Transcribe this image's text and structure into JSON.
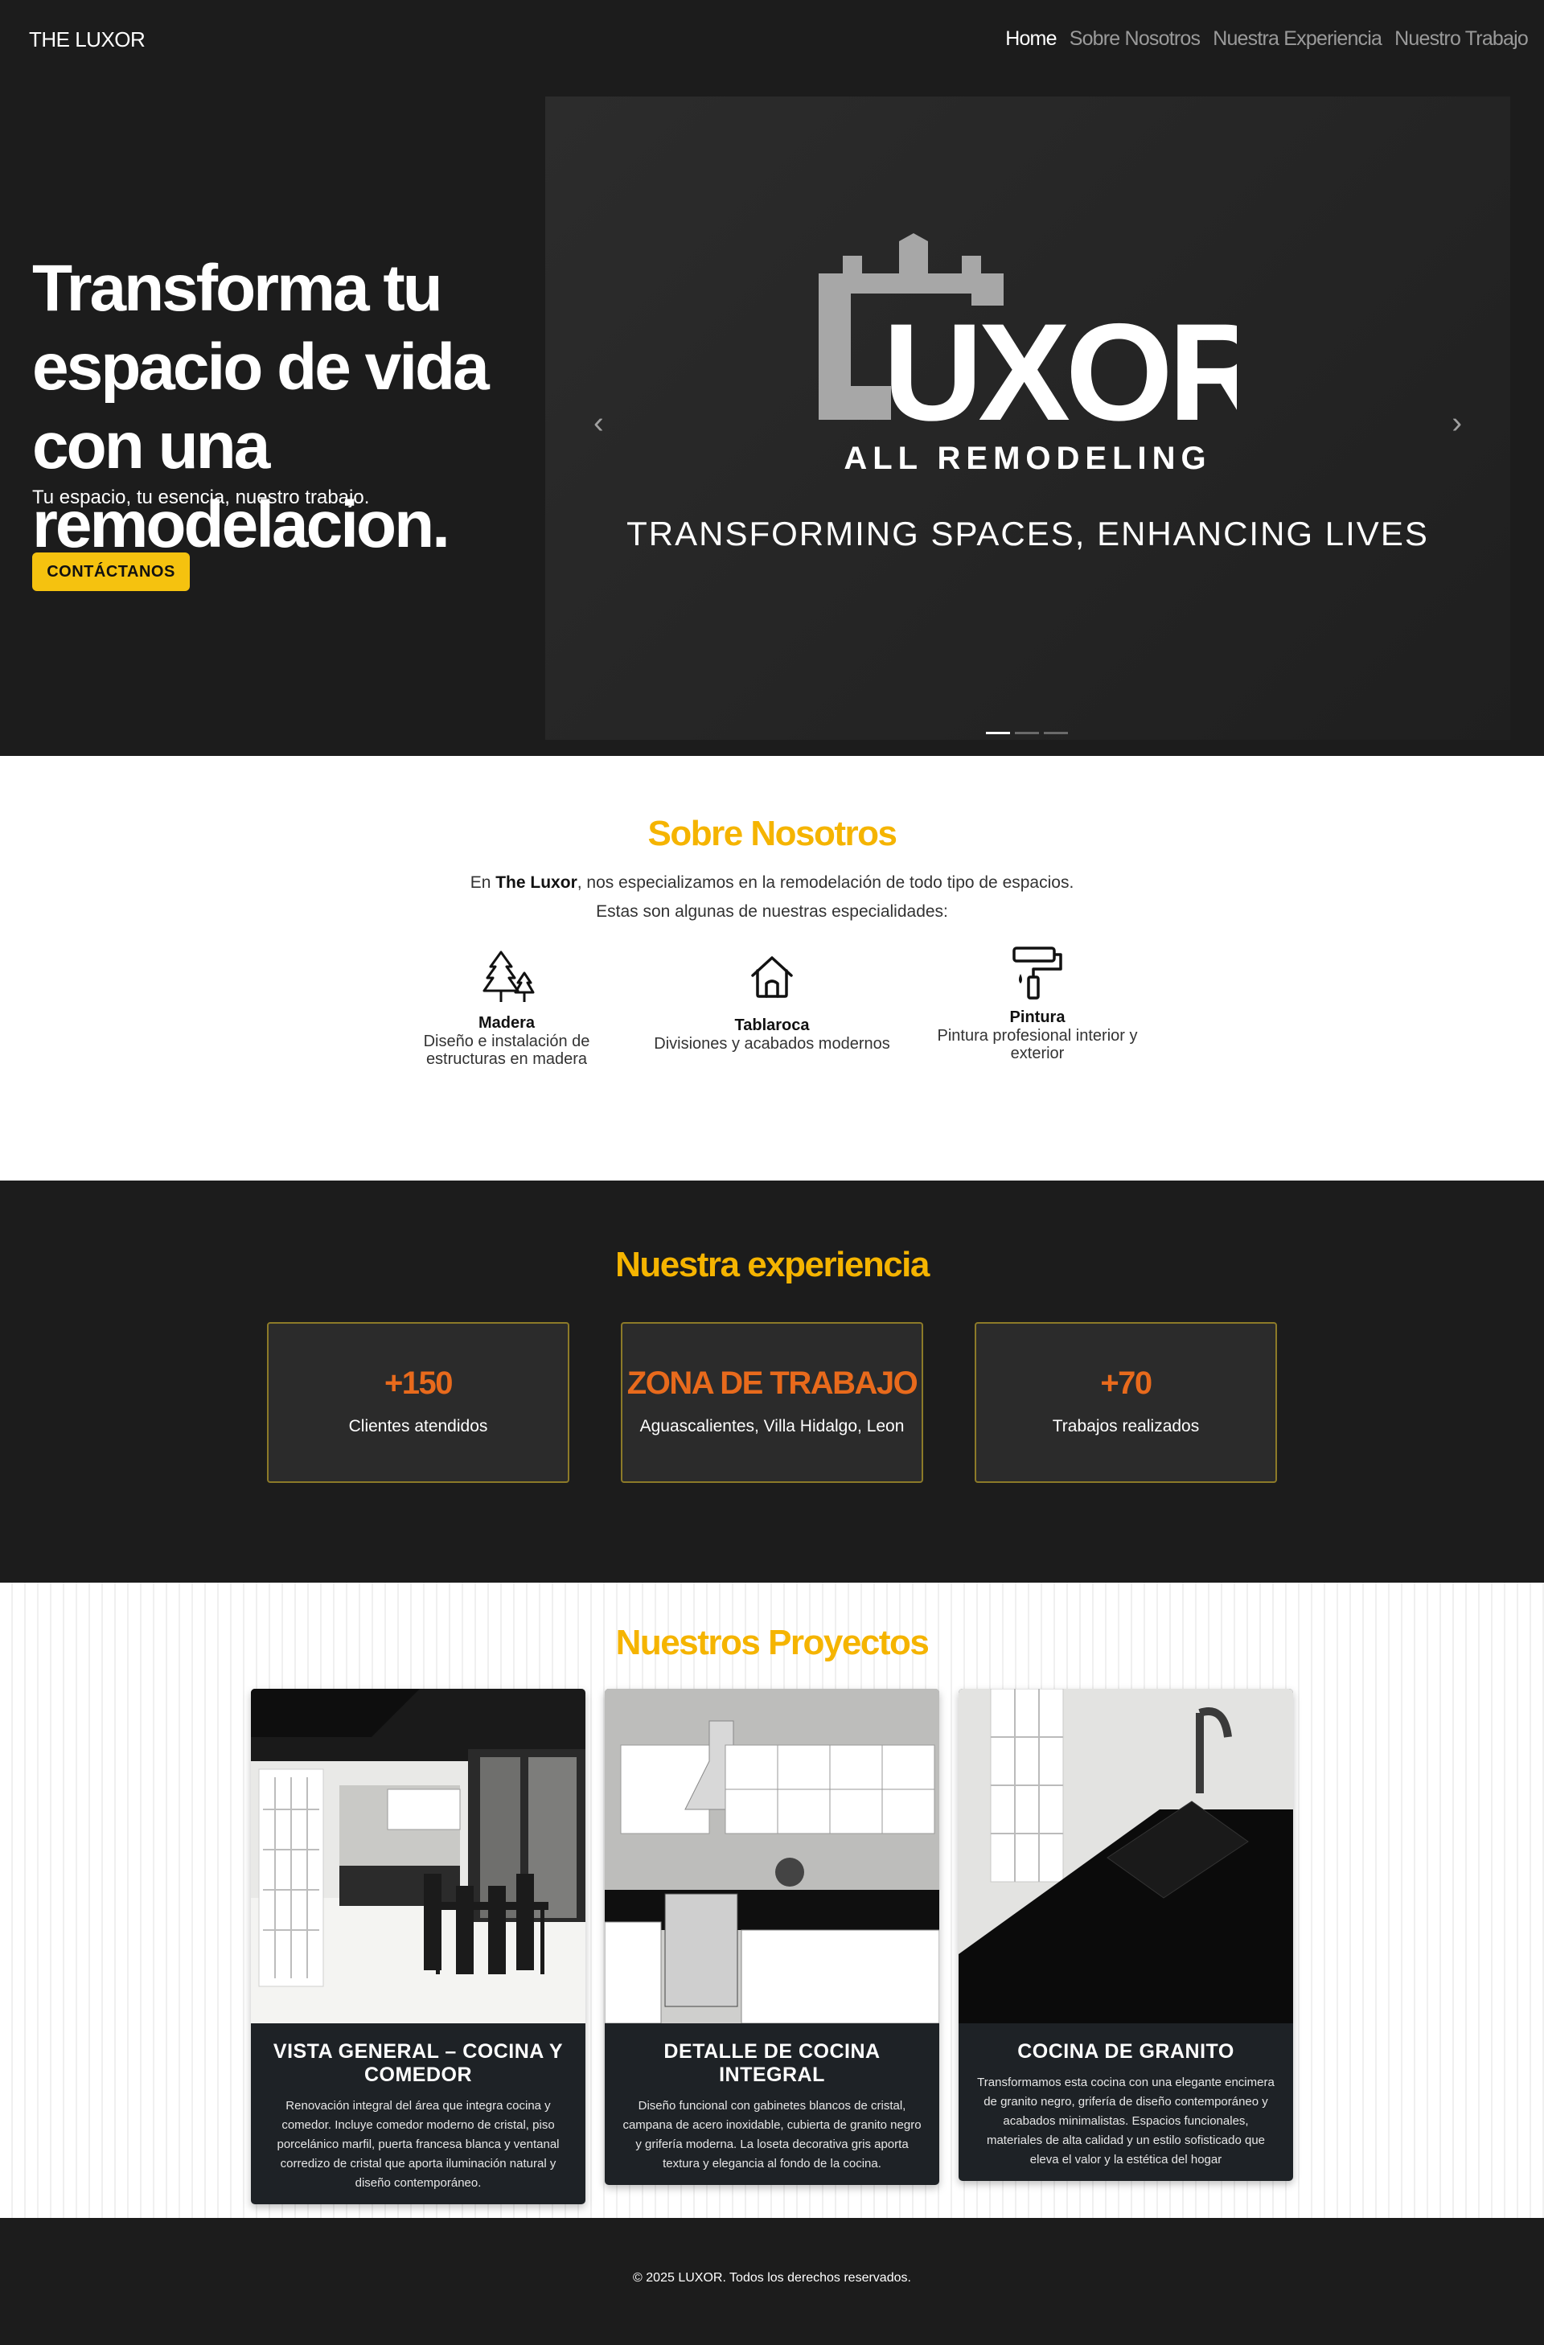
{
  "nav": {
    "brand": "THE LUXOR",
    "links": [
      "Home",
      "Sobre Nosotros",
      "Nuestra Experiencia",
      "Nuestro Trabajo"
    ]
  },
  "hero": {
    "title": "Transforma tu espacio de vida con una remodelacion.",
    "subtitle": "Tu espacio, tu esencia, nuestro trabajo.",
    "cta": "CONTÁCTANOS",
    "slide": {
      "logo_text": "UXOR",
      "logo_sub": "ALL REMODELING",
      "tagline": "TRANSFORMING SPACES, ENHANCING LIVES"
    },
    "prev_glyph": "‹",
    "next_glyph": "›"
  },
  "about": {
    "title": "Sobre Nosotros",
    "line1_pre": "En ",
    "line1_bold": "The Luxor",
    "line1_post": ", nos especializamos en la remodelación de todo tipo de espacios.",
    "line2": "Estas son algunas de nuestras especialidades:",
    "specialties": [
      {
        "icon": "trees-icon",
        "title": "Madera",
        "desc": "Diseño e instalación de estructuras en madera"
      },
      {
        "icon": "house-icon",
        "title": "Tablaroca",
        "desc": "Divisiones y acabados modernos"
      },
      {
        "icon": "paint-roller-icon",
        "title": "Pintura",
        "desc": "Pintura profesional interior y exterior"
      }
    ]
  },
  "experience": {
    "title": "Nuestra experiencia",
    "cards": [
      {
        "value": "+150",
        "label": "Clientes atendidos"
      },
      {
        "value": "ZONA DE TRABAJO",
        "label": "Aguascalientes, Villa Hidalgo, Leon"
      },
      {
        "value": "+70",
        "label": "Trabajos realizados"
      }
    ]
  },
  "projects": {
    "title": "Nuestros Proyectos",
    "items": [
      {
        "title": "VISTA GENERAL – COCINA Y COMEDOR",
        "desc": "Renovación integral del área que integra cocina y comedor. Incluye comedor moderno de cristal, piso porcelánico marfil, puerta francesa blanca y ventanal corredizo de cristal que aporta iluminación natural y diseño contemporáneo."
      },
      {
        "title": "DETALLE DE COCINA INTEGRAL",
        "desc": "Diseño funcional con gabinetes blancos de cristal, campana de acero inoxidable, cubierta de granito negro y grifería moderna. La loseta decorativa gris aporta textura y elegancia al fondo de la cocina."
      },
      {
        "title": "COCINA DE GRANITO",
        "desc": "Transformamos esta cocina con una elegante encimera de granito negro, grifería de diseño contemporáneo y acabados minimalistas. Espacios funcionales, materiales de alta calidad y un estilo sofisticado que eleva el valor y la estética del hogar"
      }
    ]
  },
  "footer": {
    "text": "© 2025 LUXOR. Todos los derechos reservados."
  },
  "colors": {
    "accent": "#f5c20f",
    "title_gold": "#f5b400",
    "value_orange": "#e86a1c",
    "dark_bg": "#1c1c1c"
  }
}
